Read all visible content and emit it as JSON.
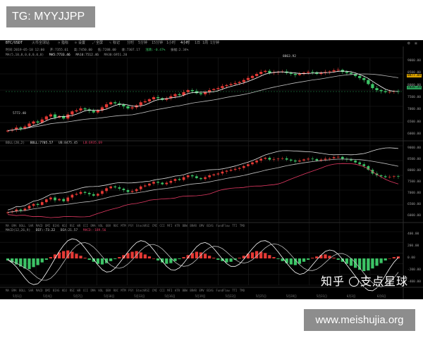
{
  "badges": {
    "tg": "TG: MYYJJPP",
    "watermark": "www.meishujia.org"
  },
  "toolbar": {
    "pair": "BTC/USDT",
    "exchange": "火币全球站",
    "buttons": [
      "指标",
      "设置",
      "全屏",
      "标记"
    ],
    "timeframes": [
      "分时",
      "5分钟",
      "15分钟",
      "1小时",
      "4小时",
      "1日",
      "1周",
      "1分钟"
    ],
    "selected_timeframe": "4小时"
  },
  "info_bar": {
    "time": "时间:2019-05-18 12:00",
    "open": "开:7355.61",
    "high": "高:7450.00",
    "low": "低:7288.00",
    "close": "收:7307.17",
    "change": "涨跌:-0.47%",
    "amplitude": "振幅:2.34%"
  },
  "ma_line": {
    "label": "MA(5,10,0,0,0,0,0,0)",
    "ma5": "MA5:7733.46",
    "ma10": "MA10:7512.46",
    "ma30": "MA30:6951.20"
  },
  "price_axis": [
    "9000.00",
    "8500.00",
    "8000.00",
    "7500.00",
    "7000.00",
    "6500.00",
    "6000.00"
  ],
  "price_tags": {
    "last_gold": "8877.84",
    "last_green": "7826.39",
    "high_label": "8863.92",
    "low_label": "5772.40"
  },
  "boll": {
    "label": "BOLL(20,2)",
    "up": "BOLL:7705.57",
    "mid": "UB:8475.45",
    "lb": "LB:6935.69"
  },
  "boll_axis": [
    "9000.00",
    "8500.00",
    "8000.00",
    "7500.00",
    "7000.00",
    "6500.00",
    "6000.00"
  ],
  "indicator_tabs": [
    "MA",
    "EMA",
    "BOLL",
    "SAR",
    "MACD",
    "DMI",
    "BIAS",
    "KDJ",
    "RSI",
    "WR",
    "CCI",
    "DMA",
    "VOL",
    "OBV",
    "ROC",
    "MTM",
    "PSY",
    "StochRSI",
    "CMI",
    "CCI",
    "MFI",
    "ATR",
    "BBW",
    "BRAR",
    "EMV",
    "BIAS",
    "FundFlow",
    "TTI",
    "TMO"
  ],
  "macd": {
    "label": "MACD(12,26,9)",
    "dif": "DIF:-73.22",
    "dea": "DEA:21.57",
    "macd": "MACD:-189.56"
  },
  "macd_axis": [
    "400.00",
    "200.00",
    "0.00",
    "-200.00",
    "-400.00"
  ],
  "zhihu": {
    "zhi": "知乎",
    "name": "支点星球"
  },
  "x_axis": [
    "5月1日",
    "5月4日",
    "5月7日",
    "5月10日",
    "5月13日",
    "5月16日",
    "5月19日",
    "5月22日",
    "5月25日",
    "5月28日",
    "5月31日",
    "6月3日",
    "6月6日"
  ],
  "colors": {
    "up": "#e53935",
    "down": "#3cc466",
    "ma5": "#ffffff",
    "ma10": "#bdbdbd",
    "boll_lb": "#e53a64",
    "last_gold": "#d8a200",
    "last_green": "#2a9b56"
  },
  "chart_data": {
    "type": "candlestick",
    "title": "BTC/USDT 4小时",
    "close": [
      5900,
      5950,
      6050,
      6000,
      6100,
      6250,
      6350,
      6300,
      6450,
      6600,
      6700,
      6550,
      6620,
      6500,
      6700,
      6850,
      6900,
      7000,
      6950,
      6880,
      6800,
      6900,
      7050,
      7200,
      7300,
      7250,
      7180,
      7100,
      7000,
      7050,
      7150,
      7300,
      7350,
      7450,
      7550,
      7500,
      7420,
      7500,
      7600,
      7700,
      7650,
      7800,
      7900,
      7850,
      7750,
      7700,
      7800,
      7900,
      7950,
      8000,
      8100,
      8150,
      8200,
      8250,
      8300,
      8400,
      8500,
      8600,
      8700,
      8800,
      8850,
      8750,
      8780,
      8800,
      8820,
      8750,
      8700,
      8650,
      8700,
      8760,
      8800,
      8780,
      8700,
      8750,
      8800,
      8820,
      8880,
      8900,
      8800,
      8750,
      8700,
      8600,
      8500,
      8400,
      8200,
      8000,
      7900,
      7850,
      7800,
      7820,
      7850,
      7830
    ],
    "macd_hist": [
      -30,
      -60,
      -90,
      -120,
      -150,
      -160,
      -130,
      -100,
      -60,
      -20,
      20,
      60,
      90,
      110,
      120,
      100,
      70,
      40,
      10,
      -20,
      -50,
      -80,
      -90,
      -70,
      -40,
      -10,
      20,
      50,
      80,
      100,
      110,
      90,
      60,
      30,
      0,
      -30,
      -60,
      -80,
      -70,
      -40,
      -10,
      20,
      50,
      80,
      100,
      90,
      70,
      40,
      10,
      -20,
      -40,
      -60,
      -50,
      -20,
      10,
      40,
      70,
      90,
      110,
      100,
      80,
      50,
      20,
      -10,
      -40,
      -70,
      -90,
      -100,
      -80,
      -50,
      -20,
      10,
      30,
      50,
      60,
      40,
      10,
      -20,
      -50,
      -80,
      -110,
      -140,
      -170,
      -190,
      -180,
      -150,
      -110,
      -70,
      -30,
      0,
      20,
      30
    ],
    "ylim": [
      5500,
      9500
    ],
    "macd_ylim": [
      -400,
      400
    ]
  }
}
